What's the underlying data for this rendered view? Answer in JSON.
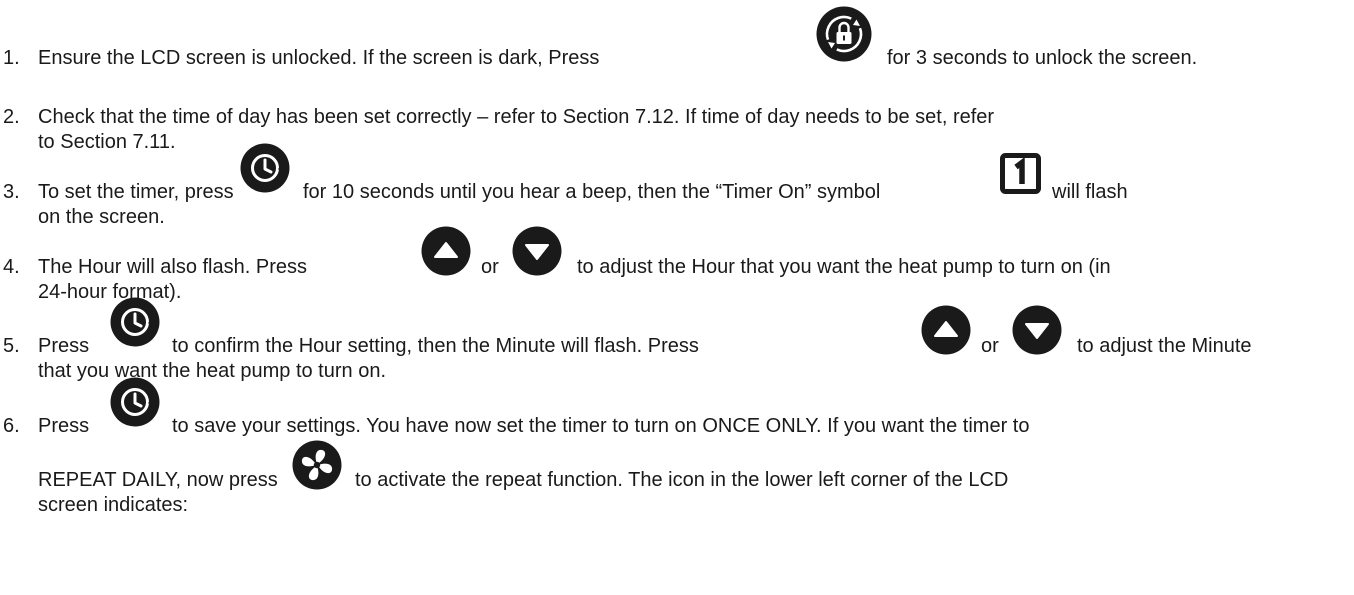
{
  "icons": {
    "lock": "lock-rotate-icon",
    "timer": "timer-clock-icon",
    "up": "up-arrow-icon",
    "down": "down-arrow-icon",
    "timer_on_symbol": "timer-on-symbol-icon",
    "fan": "fan-icon",
    "icon_color": "#1a1a1a"
  },
  "steps": [
    {
      "number": "1.",
      "seg1": "Ensure the LCD screen is unlocked. If the screen is dark, Press",
      "seg2": "for 3 seconds to unlock the screen."
    },
    {
      "number": "2.",
      "line1": "Check that the time of day has been set correctly – refer to Section 7.12. If time of day needs to be set, refer",
      "line2": "to Section 7.11."
    },
    {
      "number": "3.",
      "seg1": "To set the timer, press",
      "seg2": "for 10 seconds until you hear a beep, then the “Timer On” symbol",
      "seg3": "will flash",
      "line2": "on the screen."
    },
    {
      "number": "4.",
      "seg1": "The Hour will also flash. Press",
      "or": "or",
      "seg2": "to adjust the Hour that you want the heat pump to turn on (in",
      "line2": "24-hour format)."
    },
    {
      "number": "5.",
      "seg1": "Press",
      "seg2": "to confirm the Hour setting, then the Minute will flash. Press",
      "or": "or",
      "seg3": "to adjust the Minute",
      "line2": "that you want the heat pump to turn on."
    },
    {
      "number": "6.",
      "seg1": "Press",
      "seg2": "to save your settings. You have now set the timer to turn on ONCE ONLY. If you want the timer to",
      "line2a": "REPEAT DAILY, now press",
      "line2b": "to activate the repeat function. The icon in the lower left corner of the LCD",
      "line3": "screen indicates:"
    }
  ]
}
